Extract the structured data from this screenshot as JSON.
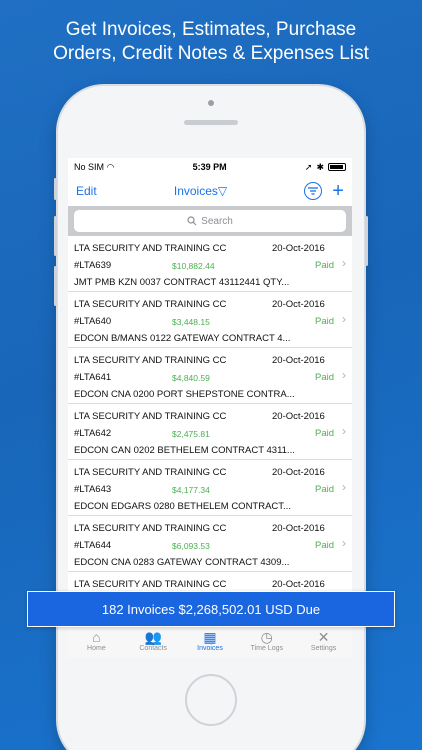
{
  "headline": {
    "line1": "Get Invoices, Estimates, Purchase",
    "line2": "Orders, Credit Notes & Expenses List"
  },
  "statusbar": {
    "carrier": "No SIM",
    "time": "5:39 PM"
  },
  "navbar": {
    "edit_label": "Edit",
    "title": "Invoices",
    "dropdown_glyph": "▽",
    "add_glyph": "+"
  },
  "search": {
    "placeholder": "Search"
  },
  "invoices": [
    {
      "client": "LTA SECURITY AND  TRAINING CC",
      "date": "20-Oct-2016",
      "number": "#LTA639",
      "amount": "$10,882.44",
      "status": "Paid",
      "description": "JMT PMB KZN 0037 CONTRACT 43112441 QTY..."
    },
    {
      "client": "LTA SECURITY AND  TRAINING CC",
      "date": "20-Oct-2016",
      "number": "#LTA640",
      "amount": "$3,448.15",
      "status": "Paid",
      "description": "EDCON B/MANS 0122 GATEWAY CONTRACT 4..."
    },
    {
      "client": "LTA SECURITY AND  TRAINING CC",
      "date": "20-Oct-2016",
      "number": "#LTA641",
      "amount": "$4,840.59",
      "status": "Paid",
      "description": "EDCON CNA 0200 PORT SHEPSTONE CONTRA..."
    },
    {
      "client": "LTA SECURITY AND  TRAINING CC",
      "date": "20-Oct-2016",
      "number": "#LTA642",
      "amount": "$2,475.81",
      "status": "Paid",
      "description": "EDCON CAN 0202 BETHELEM CONTRACT 4311..."
    },
    {
      "client": "LTA SECURITY AND  TRAINING CC",
      "date": "20-Oct-2016",
      "number": "#LTA643",
      "amount": "$4,177.34",
      "status": "Paid",
      "description": "EDCON EDGARS 0280 BETHELEM CONTRACT..."
    },
    {
      "client": "LTA SECURITY AND  TRAINING CC",
      "date": "20-Oct-2016",
      "number": "#LTA644",
      "amount": "$6,093.53",
      "status": "Paid",
      "description": "EDCON CNA 0283 GATEWAY CONTRACT 4309..."
    },
    {
      "client": "LTA SECURITY AND  TRAINING CC",
      "date": "20-Oct-2016",
      "number": "",
      "amount": "",
      "status": "",
      "description": ""
    }
  ],
  "summary": {
    "text": "182 Invoices $2,268,502.01 USD Due"
  },
  "tabs": [
    {
      "label": "Home",
      "icon": "home-icon",
      "glyph": "⌂"
    },
    {
      "label": "Contacts",
      "icon": "contacts-icon",
      "glyph": "👥"
    },
    {
      "label": "Invoices",
      "icon": "invoices-icon",
      "glyph": "▦"
    },
    {
      "label": "Time Logs",
      "icon": "clock-icon",
      "glyph": "◷"
    },
    {
      "label": "Settings",
      "icon": "settings-icon",
      "glyph": "✕"
    }
  ],
  "colors": {
    "accent": "#1a73e8",
    "paid": "#4caf50",
    "banner": "#1a66e0",
    "background": "#1866b9"
  }
}
